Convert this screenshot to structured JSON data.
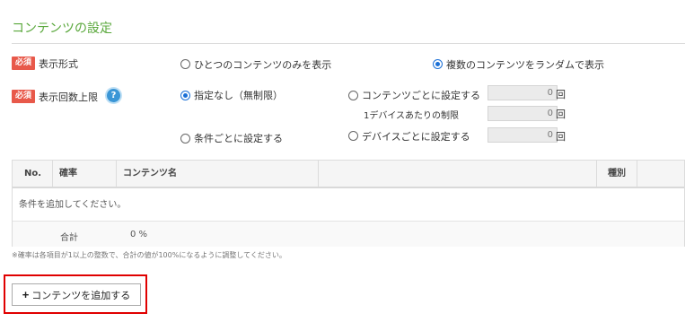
{
  "section": {
    "title": "コンテンツの設定"
  },
  "required_badge": "必須",
  "display_format": {
    "label": "表示形式",
    "options": [
      {
        "label": "ひとつのコンテンツのみを表示",
        "selected": false
      },
      {
        "label": "複数のコンテンツをランダムで表示",
        "selected": true
      }
    ]
  },
  "display_limit": {
    "label": "表示回数上限",
    "help_icon": "?",
    "options": {
      "none": {
        "label": "指定なし（無制限）",
        "selected": true
      },
      "per_content": {
        "label": "コンテンツごとに設定する",
        "selected": false,
        "value": "0",
        "unit": "回"
      },
      "per_device_sub": {
        "label": "1デバイスあたりの制限",
        "value": "0",
        "unit": "回"
      },
      "per_condition": {
        "label": "条件ごとに設定する",
        "selected": false
      },
      "per_device": {
        "label": "デバイスごとに設定する",
        "selected": false,
        "value": "0",
        "unit": "回"
      }
    }
  },
  "table": {
    "headers": {
      "no": "No.",
      "rate": "確率",
      "content_name": "コンテンツ名",
      "type": "種別"
    },
    "empty_message": "条件を追加してください。",
    "total_label": "合計",
    "total_value": "0 %"
  },
  "note": "※確率は各項目が1以上の整数で、合計の値が100%になるように調整してください。",
  "add_button": {
    "icon": "plus-icon",
    "label": "コンテンツを追加する"
  },
  "colors": {
    "accent_green": "#5aa83c",
    "badge_red": "#e8594a",
    "radio_blue": "#1a6fd6",
    "highlight_red": "#e00000"
  }
}
